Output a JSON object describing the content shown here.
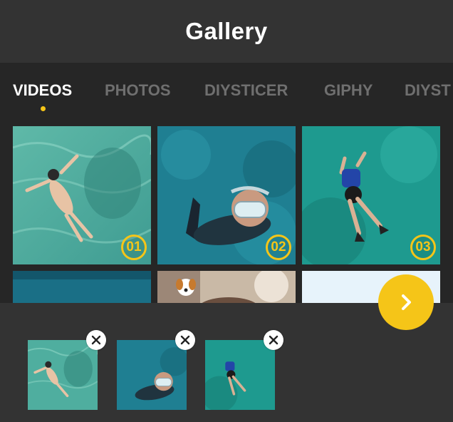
{
  "header": {
    "title": "Gallery"
  },
  "tabs": [
    {
      "label": "VIDEOS",
      "active": true
    },
    {
      "label": "PHOTOS",
      "active": false
    },
    {
      "label": "DIYSTICER",
      "active": false
    },
    {
      "label": "GIPHY",
      "active": false
    },
    {
      "label": "DIYST",
      "active": false
    }
  ],
  "grid": {
    "items": [
      {
        "name": "floating-swimmer-photo",
        "badge": "01"
      },
      {
        "name": "snorkeler-mask-photo",
        "badge": "02"
      },
      {
        "name": "diver-blue-top-photo",
        "badge": "03"
      },
      {
        "name": "ocean-photo",
        "badge": ""
      },
      {
        "name": "dog-emoji-photo",
        "badge": ""
      },
      {
        "name": "light-sky-photo",
        "badge": ""
      }
    ]
  },
  "selected": [
    {
      "name": "floating-swimmer"
    },
    {
      "name": "snorkeler-mask"
    },
    {
      "name": "diver-blue-top"
    }
  ],
  "colors": {
    "accent": "#f5c518",
    "header_bg": "#333333",
    "body_bg": "#262626",
    "tab_inactive": "#6f6f6f"
  },
  "icons": {
    "next": "chevron-right-icon",
    "remove": "close-icon"
  }
}
